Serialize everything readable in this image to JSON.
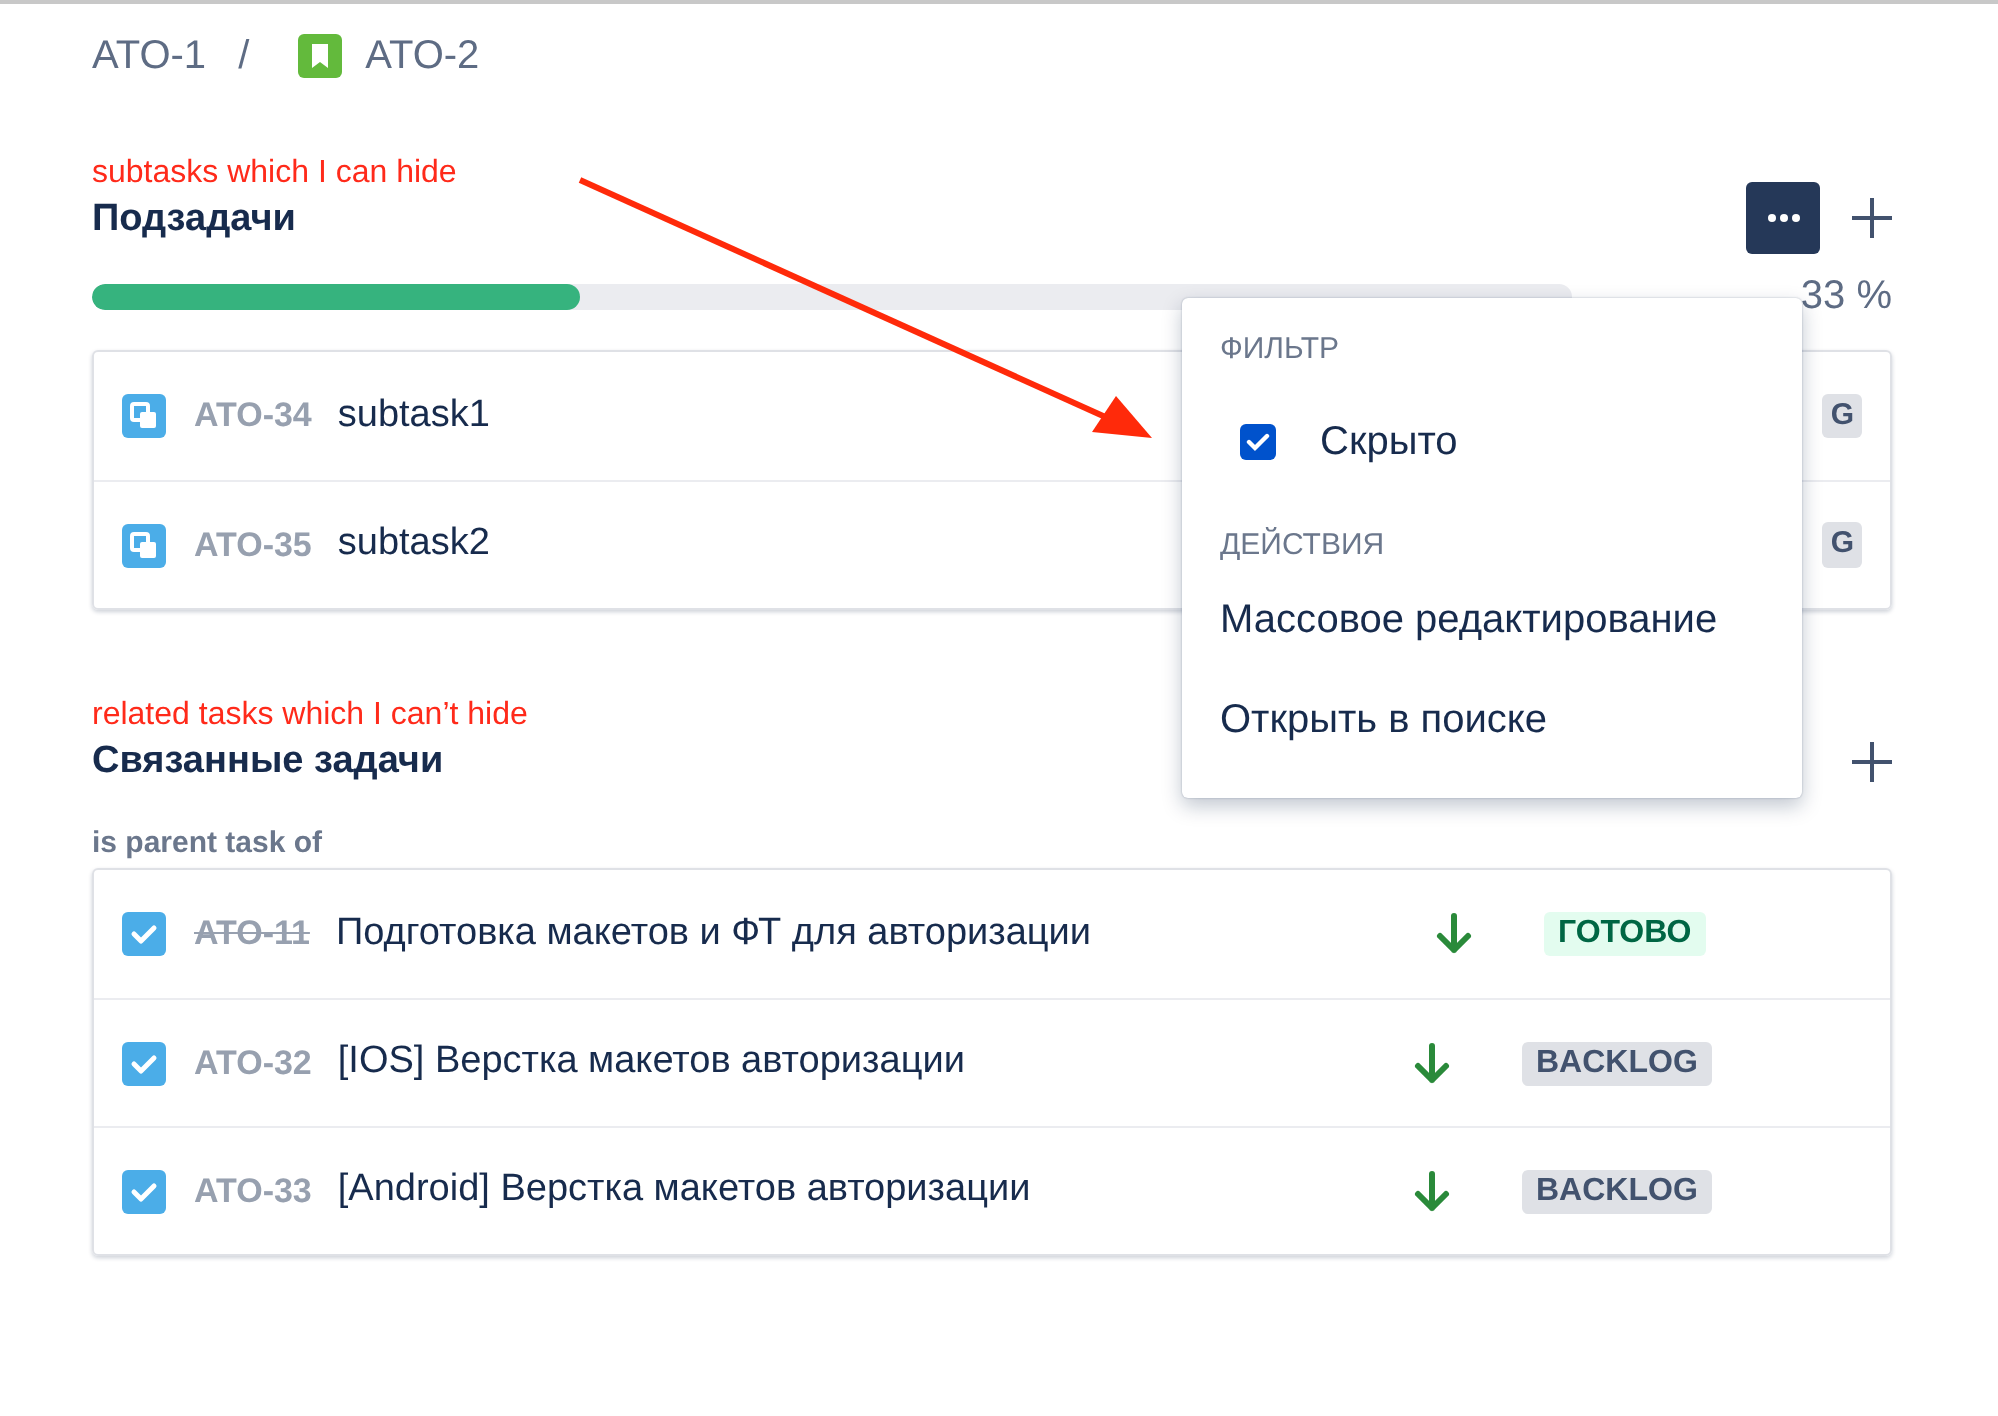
{
  "breadcrumbs": [
    {
      "label": "ATO-1",
      "kind": "plain"
    },
    {
      "label": "ATO-2",
      "kind": "story"
    }
  ],
  "breadcrumb_separator": "/",
  "subtasks": {
    "annotation": "subtasks which I can hide",
    "title": "Подзадачи",
    "progress": {
      "level": 0.33,
      "reading": "33 %"
    },
    "items": [
      {
        "key": "ATO-34",
        "title": "subtask1",
        "status": "G"
      },
      {
        "key": "ATO-35",
        "title": "subtask2",
        "status": "G"
      }
    ]
  },
  "menu": {
    "sections": [
      {
        "heading": "ФИЛЬТР",
        "items": [
          {
            "kind": "checkbox",
            "label": "Скрыто",
            "checked": true
          }
        ]
      },
      {
        "heading": "ДЕЙСТВИЯ",
        "items": [
          {
            "kind": "action",
            "label": "Массовое редактирование"
          },
          {
            "kind": "action",
            "label": "Открыть в поиске"
          }
        ]
      }
    ]
  },
  "linked": {
    "annotation": "related tasks which I can’t hide",
    "title": "Связанные задачи",
    "relation": "is parent task of",
    "items": [
      {
        "key": "ATO-11",
        "done": true,
        "title": "Подготовка макетов и ФТ для авторизации",
        "status": "ГОТОВО",
        "kind": "done"
      },
      {
        "key": "ATO-32",
        "done": false,
        "title": "[IOS] Верстка макетов авторизации",
        "status": "BACKLOG",
        "kind": "todo"
      },
      {
        "key": "ATO-33",
        "done": false,
        "title": "[Android] Верстка макетов авторизации",
        "status": "BACKLOG",
        "kind": "todo"
      }
    ]
  }
}
